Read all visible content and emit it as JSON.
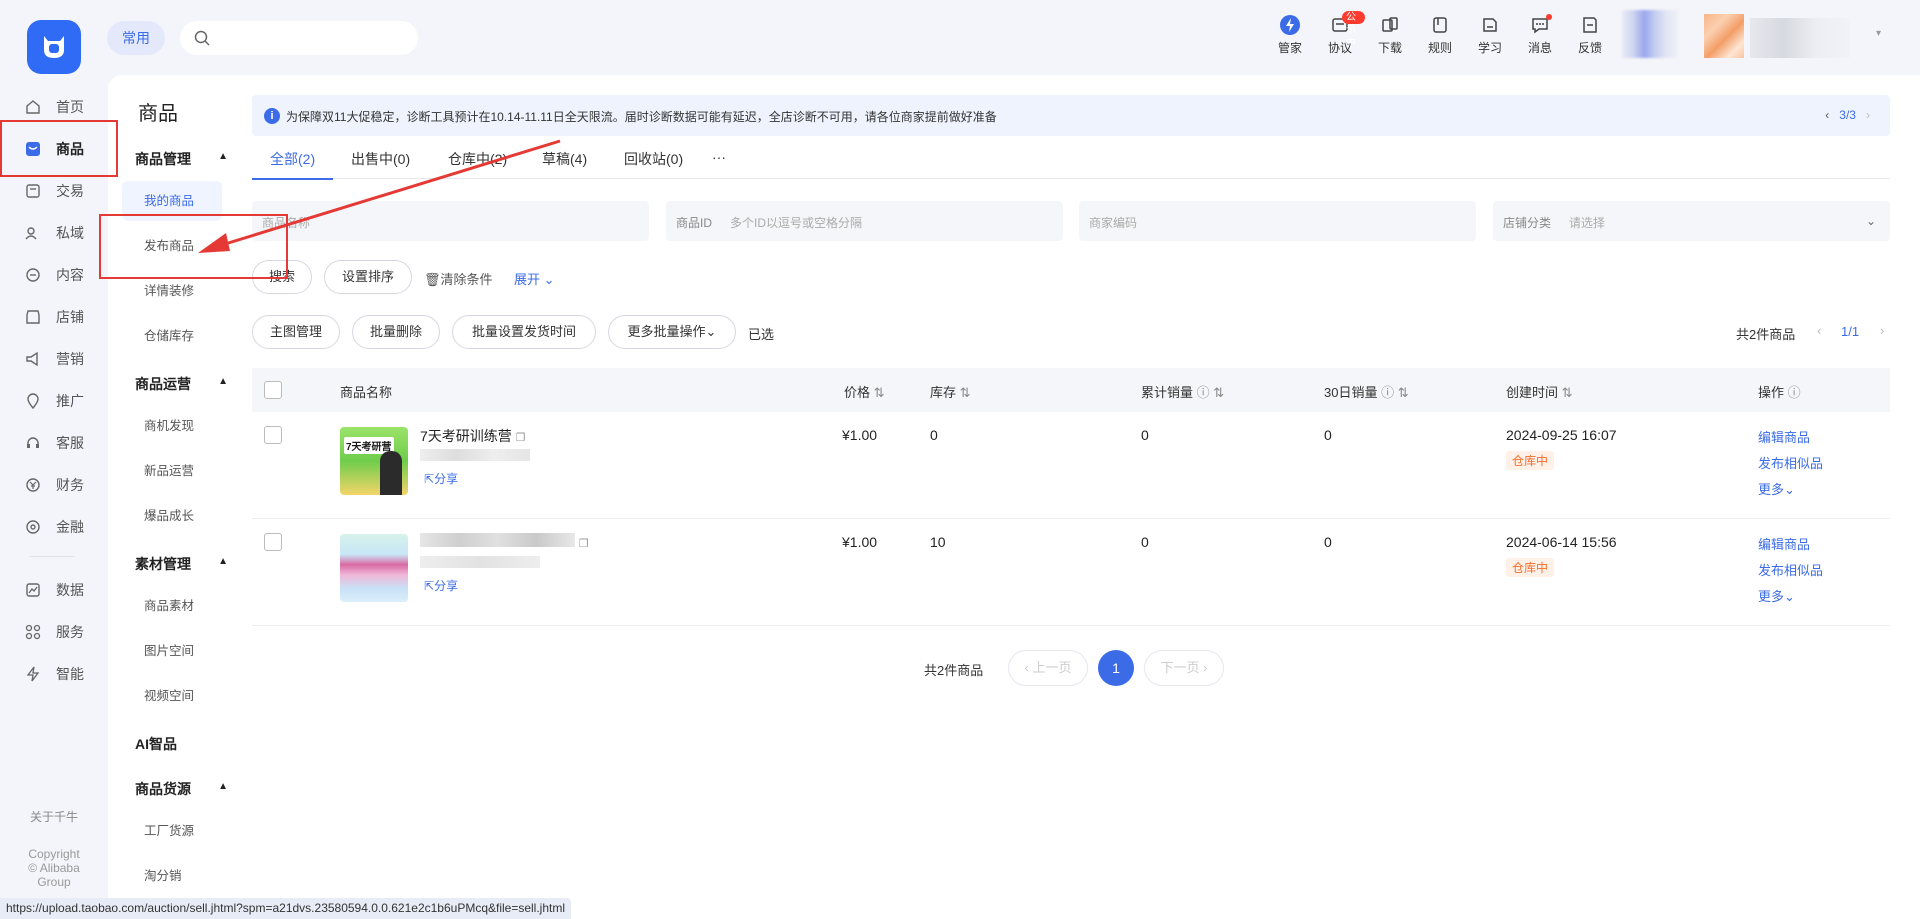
{
  "header": {
    "common_label": "常用",
    "search_placeholder": "",
    "tools": [
      {
        "label": "管家",
        "icon": "lightning-icon"
      },
      {
        "label": "协议",
        "icon": "agreement-icon",
        "badge": "公示中"
      },
      {
        "label": "下载",
        "icon": "download-icon"
      },
      {
        "label": "规则",
        "icon": "rules-book-icon"
      },
      {
        "label": "学习",
        "icon": "learning-icon"
      },
      {
        "label": "消息",
        "icon": "message-icon"
      },
      {
        "label": "反馈",
        "icon": "feedback-icon"
      }
    ]
  },
  "leftnav": {
    "items": [
      {
        "label": "首页"
      },
      {
        "label": "商品"
      },
      {
        "label": "交易"
      },
      {
        "label": "私域"
      },
      {
        "label": "内容"
      },
      {
        "label": "店铺"
      },
      {
        "label": "营销"
      },
      {
        "label": "推广"
      },
      {
        "label": "客服"
      },
      {
        "label": "财务"
      },
      {
        "label": "金融"
      },
      {
        "label": "数据"
      },
      {
        "label": "服务"
      },
      {
        "label": "智能"
      }
    ],
    "about": "关于千牛",
    "copyright": "Copyright",
    "copyright_line2": "© Alibaba",
    "copyright_line3": "Group"
  },
  "subnav": {
    "title": "商品",
    "groups": [
      {
        "label": "商品管理",
        "items": [
          "我的商品",
          "发布商品",
          "详情装修",
          "仓储库存"
        ]
      },
      {
        "label": "商品运营",
        "items": [
          "商机发现",
          "新品运营",
          "爆品成长"
        ]
      },
      {
        "label": "素材管理",
        "items": [
          "商品素材",
          "图片空间",
          "视频空间"
        ]
      },
      {
        "label": "AI智品",
        "items": []
      },
      {
        "label": "商品货源",
        "items": [
          "工厂货源",
          "淘分销"
        ]
      }
    ]
  },
  "notice": {
    "text": "为保障双11大促稳定，诊断工具预计在10.14-11.11日全天限流。届时诊断数据可能有延迟，全店诊断不可用，请各位商家提前做好准备",
    "pager": "3/3"
  },
  "tabs": [
    "全部(2)",
    "出售中(0)",
    "仓库中(2)",
    "草稿(4)",
    "回收站(0)",
    "···"
  ],
  "filters": {
    "name_placeholder": "商品名称",
    "id_label": "商品ID",
    "id_placeholder": "多个ID以逗号或空格分隔",
    "code_placeholder": "商家编码",
    "category_label": "店铺分类",
    "category_placeholder": "请选择"
  },
  "actions": {
    "search": "搜索",
    "set_sort": "设置排序",
    "clear": "清除条件",
    "expand": "展开",
    "main_image": "主图管理",
    "batch_delete": "批量删除",
    "batch_ship_time": "批量设置发货时间",
    "more_batch": "更多批量操作",
    "selected": "已选",
    "total": "共2件商品",
    "page": "1/1"
  },
  "table": {
    "headers": [
      "商品名称",
      "价格",
      "库存",
      "累计销量",
      "30日销量",
      "创建时间",
      "操作"
    ],
    "rows": [
      {
        "name": "7天考研训练营",
        "thumb_text": "7天考研营",
        "share": "分享",
        "price": "¥1.00",
        "stock": "0",
        "total_sales": "0",
        "sales_30d": "0",
        "created": "2024-09-25 16:07",
        "status": "仓库中",
        "op_edit": "编辑商品",
        "op_similar": "发布相似品",
        "op_more": "更多"
      },
      {
        "name": "",
        "thumb_text": "",
        "share": "分享",
        "price": "¥1.00",
        "stock": "10",
        "total_sales": "0",
        "sales_30d": "0",
        "created": "2024-06-14 15:56",
        "status": "仓库中",
        "op_edit": "编辑商品",
        "op_similar": "发布相似品",
        "op_more": "更多"
      }
    ]
  },
  "pagination": {
    "total": "共2件商品",
    "prev": "上一页",
    "current": "1",
    "next": "下一页"
  },
  "statusbar": {
    "url": "https://upload.taobao.com/auction/sell.jhtml?spm=a21dvs.23580594.0.0.621e2c1b6uPMcq&file=sell.jhtml"
  },
  "colors": {
    "accent": "#3b6be6",
    "annotation": "#e53935",
    "status_tag": "#f56c2d"
  }
}
